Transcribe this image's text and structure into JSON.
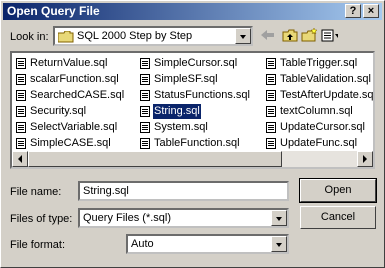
{
  "window": {
    "title": "Open Query File",
    "help_label": "?",
    "close_label": "×"
  },
  "look_in": {
    "label": "Look in:",
    "value": "SQL 2000 Step by Step"
  },
  "files": [
    {
      "name": "ReturnValue.sql"
    },
    {
      "name": "scalarFunction.sql"
    },
    {
      "name": "SearchedCASE.sql"
    },
    {
      "name": "Security.sql"
    },
    {
      "name": "SelectVariable.sql"
    },
    {
      "name": "SimpleCASE.sql"
    },
    {
      "name": "SimpleCursor.sql"
    },
    {
      "name": "SimpleSF.sql"
    },
    {
      "name": "StatusFunctions.sql"
    },
    {
      "name": "String.sql",
      "selected": true
    },
    {
      "name": "System.sql"
    },
    {
      "name": "TableFunction.sql"
    },
    {
      "name": "TableTrigger.sql"
    },
    {
      "name": "TableValidation.sql"
    },
    {
      "name": "TestAfterUpdate.sql"
    },
    {
      "name": "textColumn.sql"
    },
    {
      "name": "UpdateCursor.sql"
    },
    {
      "name": "UpdateFunc.sql"
    }
  ],
  "file_name": {
    "label": "File name:",
    "value": "String.sql"
  },
  "file_type": {
    "label": "Files of type:",
    "value": "Query Files (*.sql)"
  },
  "file_format": {
    "label": "File format:",
    "value": "Auto"
  },
  "buttons": {
    "open": "Open",
    "cancel": "Cancel"
  }
}
